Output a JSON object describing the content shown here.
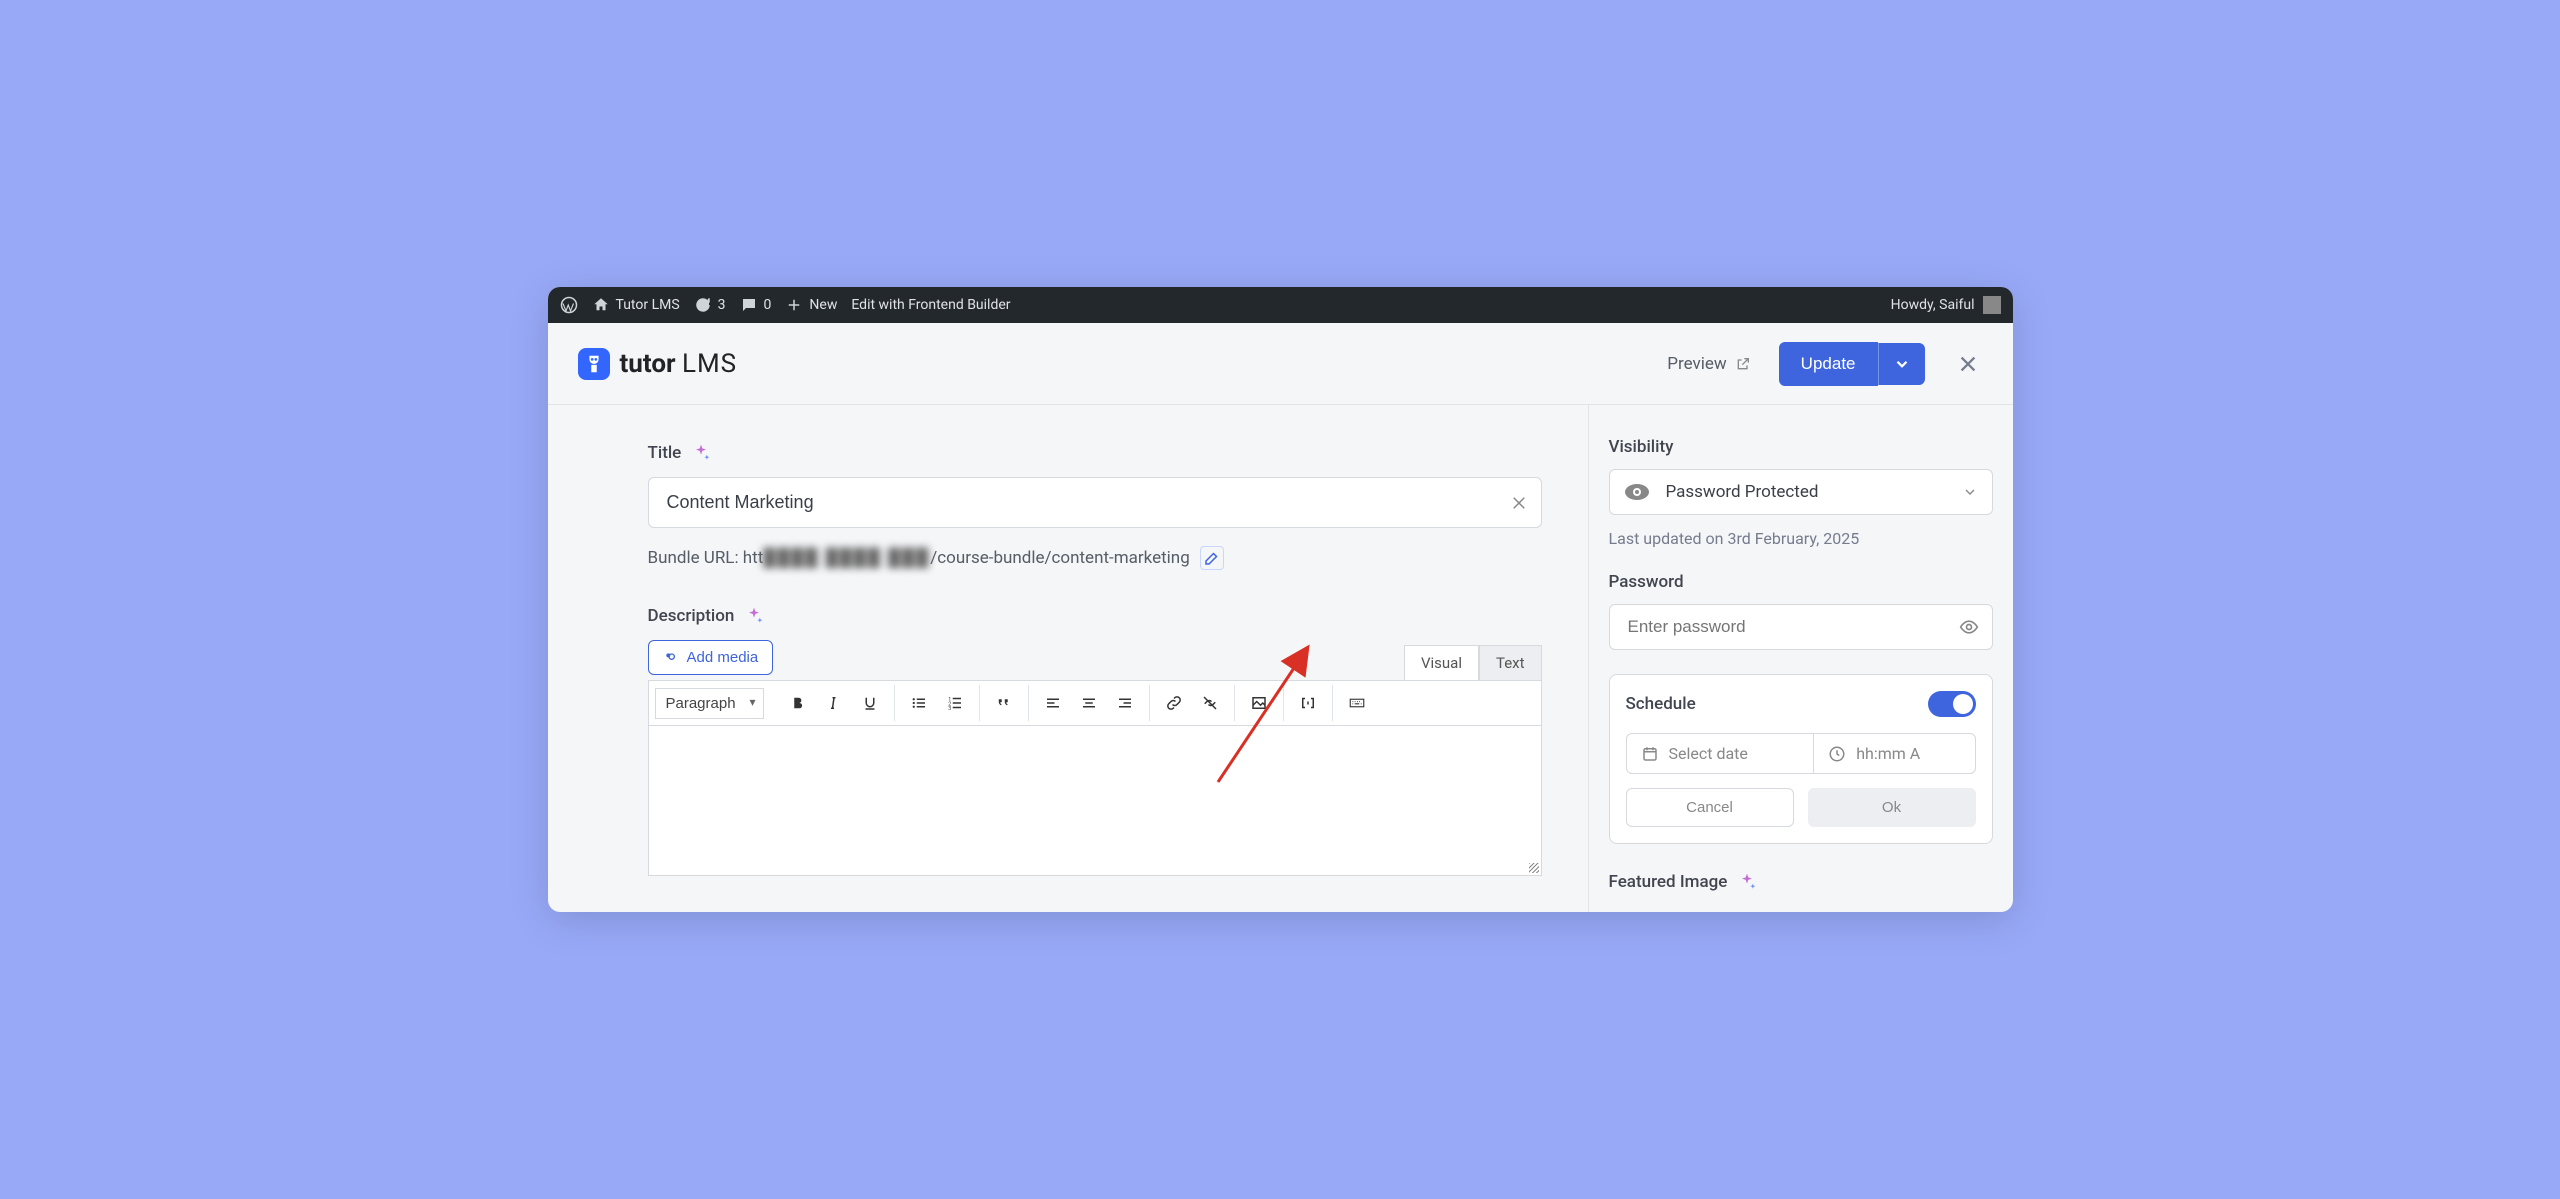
{
  "wp_bar": {
    "site_name": "Tutor LMS",
    "updates": "3",
    "comments": "0",
    "new": "New",
    "frontend_builder": "Edit with Frontend Builder",
    "howdy": "Howdy, Saiful"
  },
  "header": {
    "logo_main": "tutor",
    "logo_sub": "LMS",
    "preview": "Preview",
    "update": "Update"
  },
  "main": {
    "title_label": "Title",
    "title_value": "Content Marketing",
    "bundle_url_label": "Bundle URL: ",
    "bundle_url_prefix": "htt",
    "bundle_url_blur": "████ ████ ███",
    "bundle_url_suffix": "/course-bundle/content-marketing",
    "description_label": "Description",
    "add_media": "Add media",
    "tabs": {
      "visual": "Visual",
      "text": "Text"
    },
    "paragraph": "Paragraph"
  },
  "sidebar": {
    "visibility_label": "Visibility",
    "visibility_value": "Password Protected",
    "last_updated": "Last updated on 3rd February, 2025",
    "password_label": "Password",
    "password_placeholder": "Enter password",
    "schedule_label": "Schedule",
    "date_placeholder": "Select date",
    "time_placeholder": "hh:mm A",
    "cancel": "Cancel",
    "ok": "Ok",
    "featured_image": "Featured Image"
  }
}
